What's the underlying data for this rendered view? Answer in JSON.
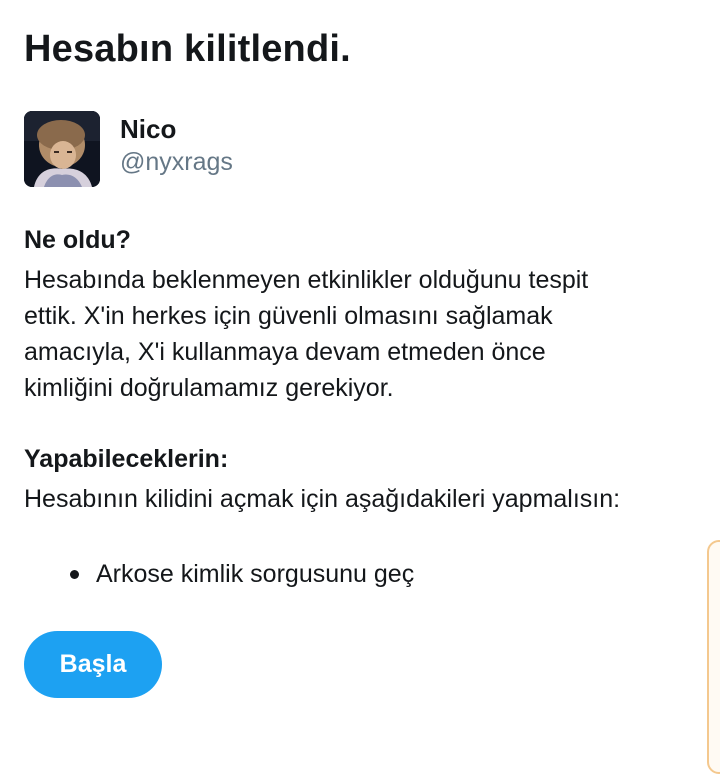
{
  "page": {
    "title": "Hesabın kilitlendi."
  },
  "account": {
    "display_name": "Nico",
    "handle": "@nyxrags",
    "avatar_icon": "profile-photo"
  },
  "what_happened": {
    "heading": "Ne oldu?",
    "lines": [
      "Hesabında beklenmeyen etkinlikler olduğunu tespit",
      "ettik. X'in herkes için güvenli olmasını sağlamak",
      "amacıyla, X'i kullanmaya devam etmeden önce",
      "kimliğini doğrulamamız gerekiyor."
    ]
  },
  "what_you_can_do": {
    "heading": "Yapabileceklerin:",
    "body": "Hesabının kilidini açmak için aşağıdakileri yapmalısın:",
    "items": [
      "Arkose kimlik sorgusunu geç"
    ]
  },
  "actions": {
    "start_label": "Başla"
  },
  "colors": {
    "primary_text": "#14171a",
    "secondary_text": "#657786",
    "accent": "#1da1f2"
  }
}
